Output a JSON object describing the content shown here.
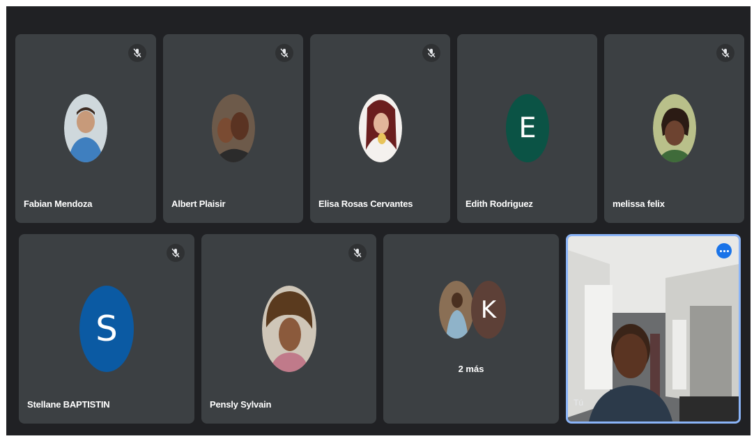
{
  "participants": [
    {
      "name": "Fabian Mendoza",
      "avatar": "photo",
      "muted": true
    },
    {
      "name": "Albert Plaisir",
      "avatar": "photo",
      "muted": true
    },
    {
      "name": "Elisa Rosas Cervantes",
      "avatar": "photo",
      "muted": true
    },
    {
      "name": "Edith Rodriguez",
      "avatar": "letter",
      "letter": "E",
      "color": "#0b5345",
      "muted": false
    },
    {
      "name": "melissa felix",
      "avatar": "photo",
      "muted": true
    },
    {
      "name": "Stellane BAPTISTIN",
      "avatar": "letter",
      "letter": "S",
      "color": "#0b5aa3",
      "muted": true
    },
    {
      "name": "Pensly Sylvain",
      "avatar": "photo",
      "muted": true
    }
  ],
  "more_tile": {
    "letter": "K",
    "letter_color": "#5d4037",
    "label": "2 más"
  },
  "self_tile": {
    "label": "Tú",
    "accent": "#8ab4f8",
    "options_color": "#1a73e8"
  },
  "icons": {
    "mic": "mic-off-icon",
    "options": "more-options-icon"
  }
}
